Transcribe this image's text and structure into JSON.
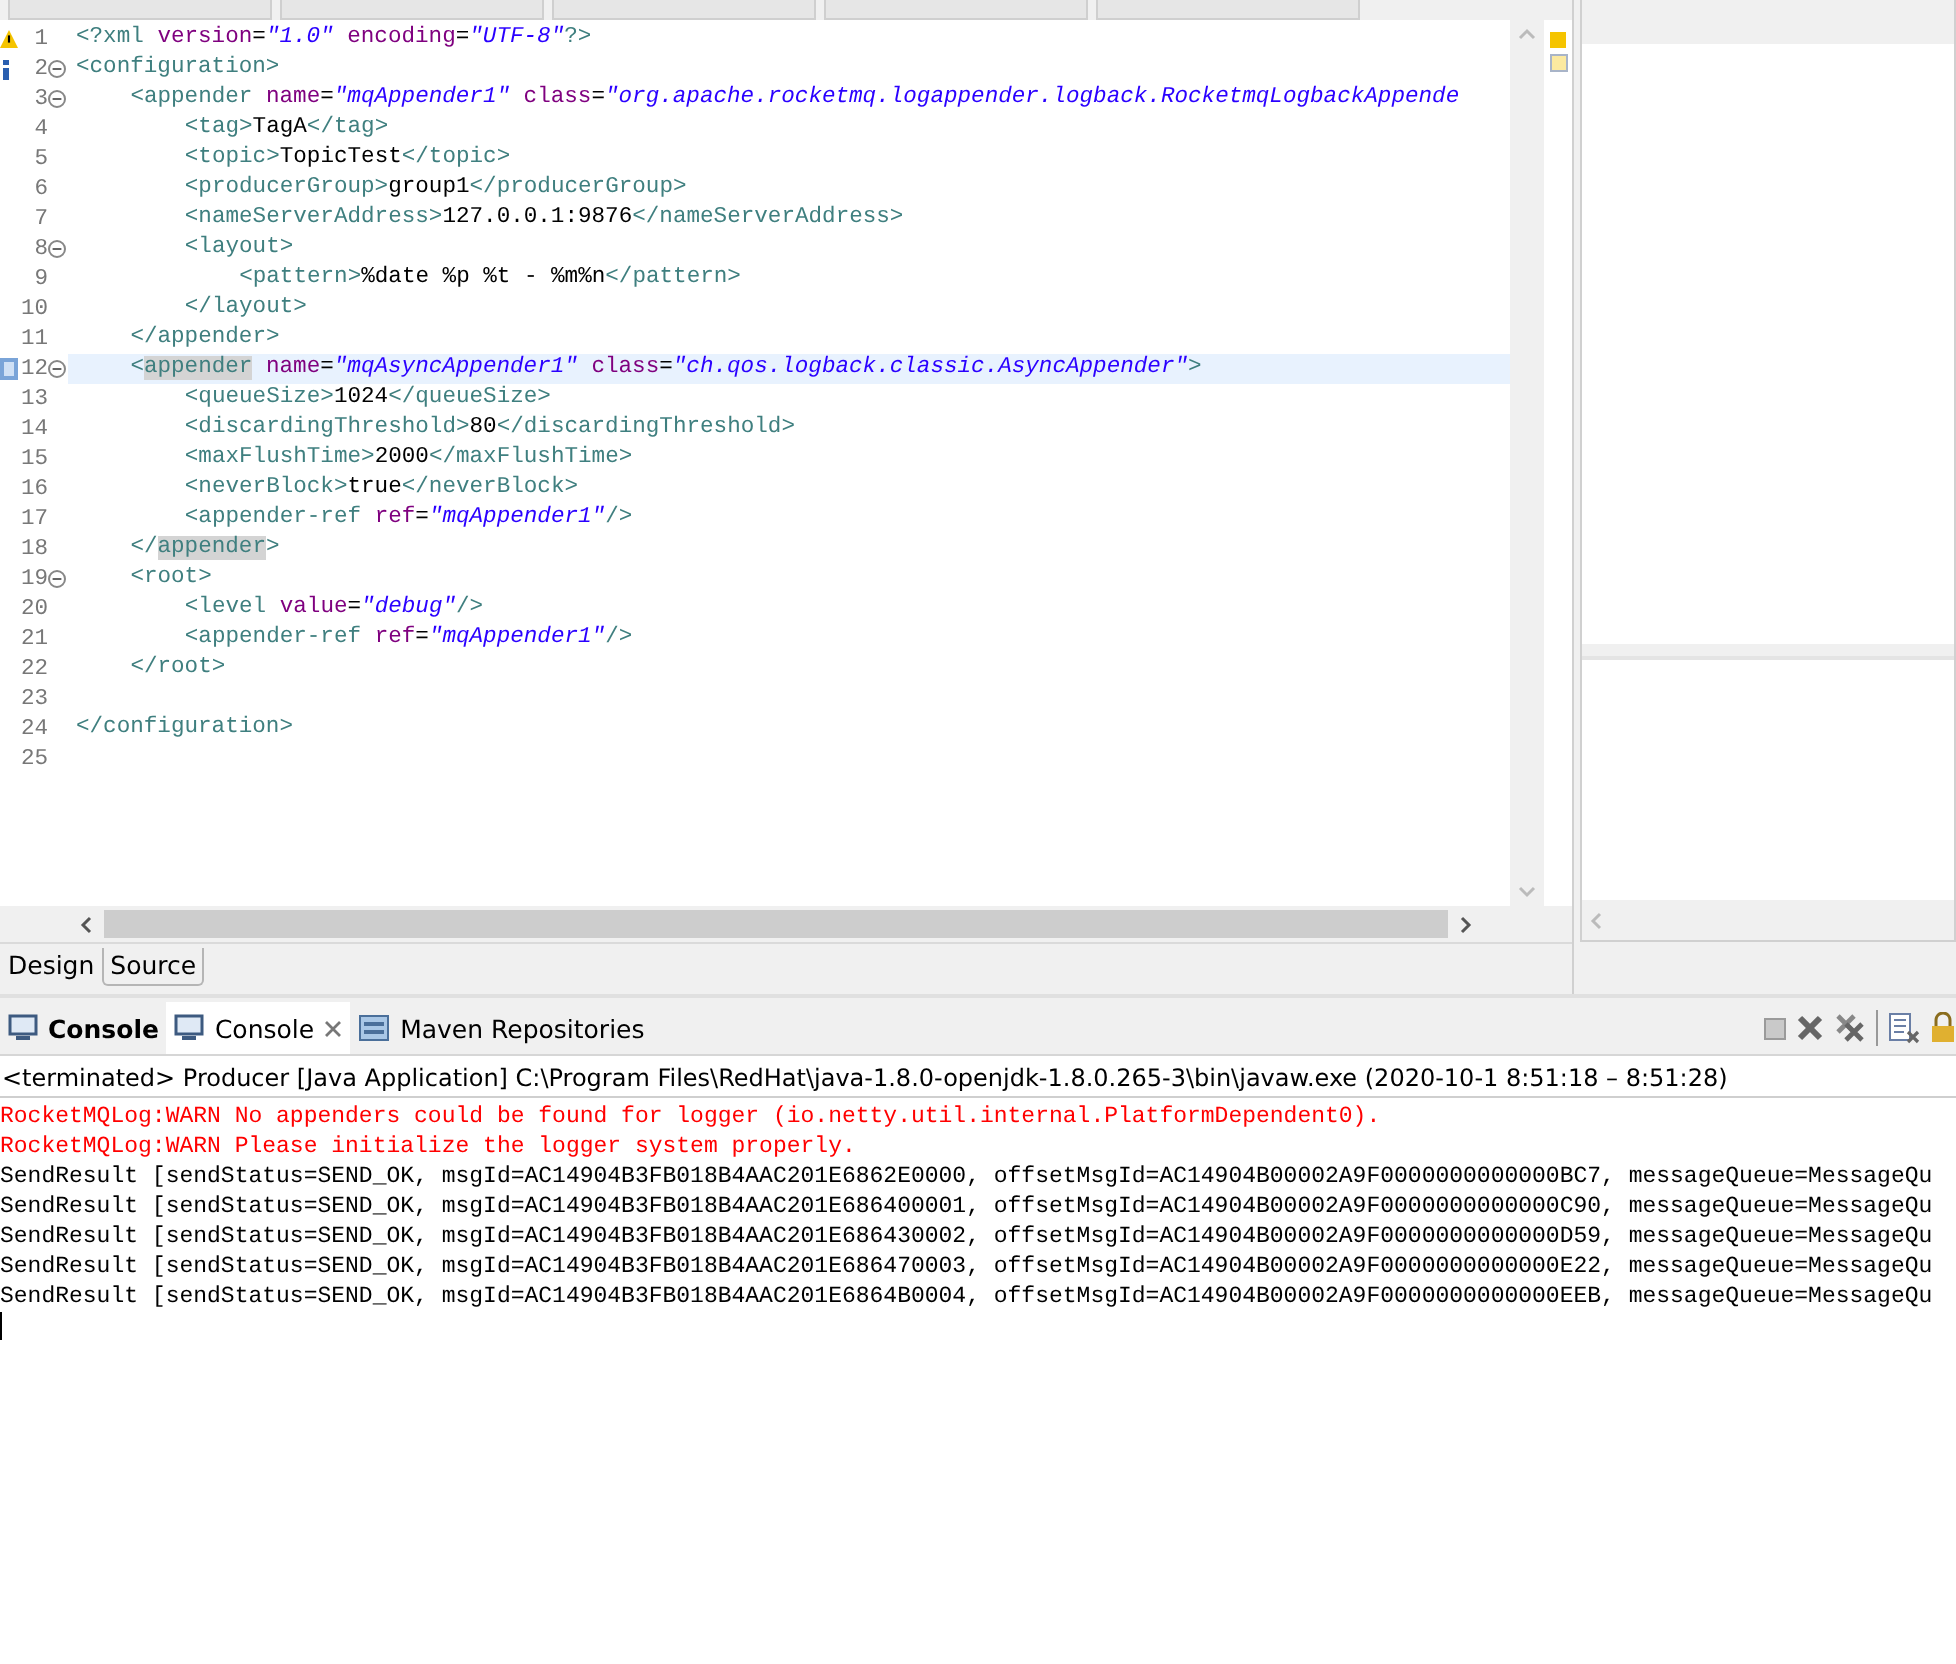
{
  "editor": {
    "lines": [
      {
        "number": "1",
        "kind": "warning",
        "foldable": false,
        "current": false,
        "tokens": [
          {
            "kind": "tag",
            "t": "<?xml "
          },
          {
            "kind": "attr",
            "t": "version"
          },
          {
            "kind": "text",
            "t": "="
          },
          {
            "kind": "value",
            "t": "\"1.0\""
          },
          {
            "kind": "attr",
            "t": " encoding"
          },
          {
            "kind": "text",
            "t": "="
          },
          {
            "kind": "value",
            "t": "\"UTF-8\""
          },
          {
            "kind": "tag",
            "t": "?>"
          }
        ]
      },
      {
        "number": "2",
        "kind": "info",
        "foldable": true,
        "current": false,
        "tokens": [
          {
            "kind": "tag",
            "t": "<configuration>"
          }
        ]
      },
      {
        "number": "3",
        "kind": "none",
        "foldable": true,
        "current": false,
        "tokens": [
          {
            "kind": "tag",
            "t": "<appender "
          },
          {
            "kind": "attr",
            "t": "name"
          },
          {
            "kind": "text",
            "t": "="
          },
          {
            "kind": "value",
            "t": "\"mqAppender1\""
          },
          {
            "kind": "attr",
            "t": " class"
          },
          {
            "kind": "text",
            "t": "="
          },
          {
            "kind": "value",
            "t": "\"org.apache.rocketmq.logappender.logback.RocketmqLogbackAppende"
          }
        ]
      },
      {
        "number": "4",
        "kind": "none",
        "foldable": false,
        "current": false,
        "tokens": [
          {
            "kind": "tag",
            "t": "<tag>"
          },
          {
            "kind": "text",
            "t": "TagA"
          },
          {
            "kind": "tag",
            "t": "</tag>"
          }
        ]
      },
      {
        "number": "5",
        "kind": "none",
        "foldable": false,
        "current": false,
        "tokens": [
          {
            "kind": "tag",
            "t": "<topic>"
          },
          {
            "kind": "text",
            "t": "TopicTest"
          },
          {
            "kind": "tag",
            "t": "</topic>"
          }
        ]
      },
      {
        "number": "6",
        "kind": "none",
        "foldable": false,
        "current": false,
        "tokens": [
          {
            "kind": "tag",
            "t": "<producerGroup>"
          },
          {
            "kind": "text",
            "t": "group1"
          },
          {
            "kind": "tag",
            "t": "</producerGroup>"
          }
        ]
      },
      {
        "number": "7",
        "kind": "none",
        "foldable": false,
        "current": false,
        "tokens": [
          {
            "kind": "tag",
            "t": "<nameServerAddress>"
          },
          {
            "kind": "text",
            "t": "127.0.0.1:9876"
          },
          {
            "kind": "tag",
            "t": "</nameServerAddress>"
          }
        ]
      },
      {
        "number": "8",
        "kind": "none",
        "foldable": true,
        "current": false,
        "tokens": [
          {
            "kind": "tag",
            "t": "<layout>"
          }
        ]
      },
      {
        "number": "9",
        "kind": "none",
        "foldable": false,
        "current": false,
        "tokens": [
          {
            "kind": "tag",
            "t": "<pattern>"
          },
          {
            "kind": "text",
            "t": "%date %p %t - %m%n"
          },
          {
            "kind": "tag",
            "t": "</pattern>"
          }
        ]
      },
      {
        "number": "10",
        "kind": "none",
        "foldable": false,
        "current": false,
        "tokens": [
          {
            "kind": "tag",
            "t": "</layout>"
          }
        ]
      },
      {
        "number": "11",
        "kind": "none",
        "foldable": false,
        "current": false,
        "tokens": [
          {
            "kind": "tag",
            "t": "</appender>"
          }
        ]
      },
      {
        "number": "12",
        "kind": "bookmark",
        "foldable": true,
        "current": true,
        "tokens": [
          {
            "kind": "tag",
            "t": "<"
          },
          {
            "kind": "match",
            "t": "appender"
          },
          {
            "kind": "attr",
            "t": " name"
          },
          {
            "kind": "text",
            "t": "="
          },
          {
            "kind": "value",
            "t": "\"mqAsyncAppender1\""
          },
          {
            "kind": "attr",
            "t": " class"
          },
          {
            "kind": "text",
            "t": "="
          },
          {
            "kind": "value",
            "t": "\"ch.qos.logback.classic.AsyncAppender\""
          },
          {
            "kind": "tag",
            "t": ">"
          }
        ]
      },
      {
        "number": "13",
        "kind": "none",
        "foldable": false,
        "current": false,
        "tokens": [
          {
            "kind": "tag",
            "t": "<queueSize>"
          },
          {
            "kind": "text",
            "t": "1024"
          },
          {
            "kind": "tag",
            "t": "</queueSize>"
          }
        ]
      },
      {
        "number": "14",
        "kind": "none",
        "foldable": false,
        "current": false,
        "tokens": [
          {
            "kind": "tag",
            "t": "<discardingThreshold>"
          },
          {
            "kind": "text",
            "t": "80"
          },
          {
            "kind": "tag",
            "t": "</discardingThreshold>"
          }
        ]
      },
      {
        "number": "15",
        "kind": "none",
        "foldable": false,
        "current": false,
        "tokens": [
          {
            "kind": "tag",
            "t": "<maxFlushTime>"
          },
          {
            "kind": "text",
            "t": "2000"
          },
          {
            "kind": "tag",
            "t": "</maxFlushTime>"
          }
        ]
      },
      {
        "number": "16",
        "kind": "none",
        "foldable": false,
        "current": false,
        "tokens": [
          {
            "kind": "tag",
            "t": "<neverBlock>"
          },
          {
            "kind": "text",
            "t": "true"
          },
          {
            "kind": "tag",
            "t": "</neverBlock>"
          }
        ]
      },
      {
        "number": "17",
        "kind": "none",
        "foldable": false,
        "current": false,
        "tokens": [
          {
            "kind": "tag",
            "t": "<appender-ref "
          },
          {
            "kind": "attr",
            "t": "ref"
          },
          {
            "kind": "text",
            "t": "="
          },
          {
            "kind": "value",
            "t": "\"mqAppender1\""
          },
          {
            "kind": "tag",
            "t": "/>"
          }
        ]
      },
      {
        "number": "18",
        "kind": "none",
        "foldable": false,
        "current": false,
        "tokens": [
          {
            "kind": "tag",
            "t": "</"
          },
          {
            "kind": "match",
            "t": "appender"
          },
          {
            "kind": "tag",
            "t": ">"
          }
        ]
      },
      {
        "number": "19",
        "kind": "none",
        "foldable": true,
        "current": false,
        "tokens": [
          {
            "kind": "tag",
            "t": "<root>"
          }
        ]
      },
      {
        "number": "20",
        "kind": "none",
        "foldable": false,
        "current": false,
        "tokens": [
          {
            "kind": "tag",
            "t": "<level "
          },
          {
            "kind": "attr",
            "t": "value"
          },
          {
            "kind": "text",
            "t": "="
          },
          {
            "kind": "value",
            "t": "\"debug\""
          },
          {
            "kind": "tag",
            "t": "/>"
          }
        ]
      },
      {
        "number": "21",
        "kind": "none",
        "foldable": false,
        "current": false,
        "tokens": [
          {
            "kind": "tag",
            "t": "<appender-ref "
          },
          {
            "kind": "attr",
            "t": "ref"
          },
          {
            "kind": "text",
            "t": "="
          },
          {
            "kind": "value",
            "t": "\"mqAppender1\""
          },
          {
            "kind": "tag",
            "t": "/>"
          }
        ]
      },
      {
        "number": "22",
        "kind": "none",
        "foldable": false,
        "current": false,
        "tokens": [
          {
            "kind": "tag",
            "t": "</root>"
          }
        ]
      },
      {
        "number": "23",
        "kind": "none",
        "foldable": false,
        "current": false
      },
      {
        "number": "24",
        "kind": "none",
        "foldable": false,
        "current": false,
        "tokens": [
          {
            "kind": "tag",
            "t": "</configuration>"
          }
        ]
      },
      {
        "number": "25",
        "kind": "none",
        "foldable": false,
        "current": false
      }
    ],
    "page_tabs": [
      {
        "label": "Design",
        "selected": false
      },
      {
        "label": "Source",
        "selected": true
      }
    ]
  },
  "console": {
    "tabs": [
      {
        "label": "Console",
        "selected": false,
        "bold": true,
        "closable": false
      },
      {
        "label": "Console",
        "selected": true,
        "bold": false,
        "closable": true
      },
      {
        "label": "Maven Repositories",
        "selected": false,
        "bold": false,
        "closable": false
      }
    ],
    "header": "<terminated> Producer [Java Application] C:\\Program Files\\RedHat\\java-1.8.0-openjdk-1.8.0.265-3\\bin\\javaw.exe  (2020-10-1 8:51:18 – 8:51:28)",
    "lines": [
      {
        "kind": "error",
        "text": "RocketMQLog:WARN No appenders could be found for logger (io.netty.util.internal.PlatformDependent0)."
      },
      {
        "kind": "error",
        "text": "RocketMQLog:WARN Please initialize the logger system properly."
      },
      {
        "kind": "output",
        "text": "SendResult [sendStatus=SEND_OK, msgId=AC14904B3FB018B4AAC201E6862E0000, offsetMsgId=AC14904B00002A9F0000000000000BC7, messageQueue=MessageQu"
      },
      {
        "kind": "output",
        "text": "SendResult [sendStatus=SEND_OK, msgId=AC14904B3FB018B4AAC201E686400001, offsetMsgId=AC14904B00002A9F0000000000000C90, messageQueue=MessageQu"
      },
      {
        "kind": "output",
        "text": "SendResult [sendStatus=SEND_OK, msgId=AC14904B3FB018B4AAC201E686430002, offsetMsgId=AC14904B00002A9F0000000000000D59, messageQueue=MessageQu"
      },
      {
        "kind": "output",
        "text": "SendResult [sendStatus=SEND_OK, msgId=AC14904B3FB018B4AAC201E686470003, offsetMsgId=AC14904B00002A9F0000000000000E22, messageQueue=MessageQu"
      },
      {
        "kind": "output",
        "text": "SendResult [sendStatus=SEND_OK, msgId=AC14904B3FB018B4AAC201E6864B0004, offsetMsgId=AC14904B00002A9F0000000000000EEB, messageQueue=MessageQu"
      }
    ]
  }
}
